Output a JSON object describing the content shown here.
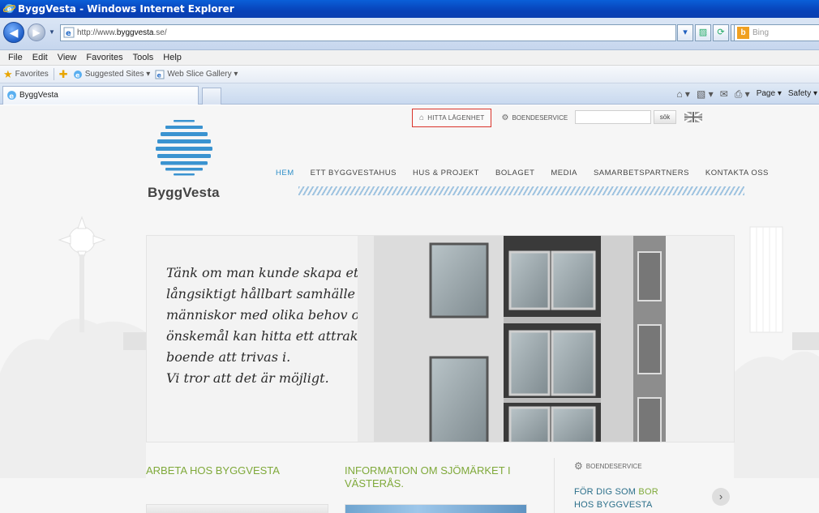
{
  "window": {
    "title": "ByggVesta - Windows Internet Explorer"
  },
  "address": {
    "url_prefix": "http://www.",
    "url_domain": "byggvesta",
    "url_suffix": ".se/",
    "search_placeholder": "Bing"
  },
  "menu": {
    "items": [
      "File",
      "Edit",
      "View",
      "Favorites",
      "Tools",
      "Help"
    ]
  },
  "favorites": {
    "label": "Favorites",
    "suggested": "Suggested Sites ▾",
    "gallery": "Web Slice Gallery ▾"
  },
  "tabs": {
    "active_label": "ByggVesta"
  },
  "commandbar": {
    "page": "Page ▾",
    "safety": "Safety ▾"
  },
  "site": {
    "logo_text": "ByggVesta",
    "top_links": {
      "hitta": "HITTA LÄGENHET",
      "boende": "BOENDESERVICE",
      "search_button": "sök"
    },
    "nav": [
      "HEM",
      "ETT BYGGVESTAHUS",
      "HUS & PROJEKT",
      "BOLAGET",
      "MEDIA",
      "SAMARBETSPARTNERS",
      "KONTAKTA OSS"
    ],
    "hero_lines": [
      "Tänk om man kunde skapa ett",
      "långsiktigt hållbart samhälle där",
      "människor med olika behov och",
      "önskemål kan hitta ett attraktivt",
      "boende att trivas i.",
      "Vi tror att det är möjligt."
    ],
    "col1_title": "ARBETA HOS BYGGVESTA",
    "col2_title_1": "INFORMATION OM SJÖMÄRKET I",
    "col2_title_2": "VÄSTERÅS.",
    "col3_label": "BOENDESERVICE",
    "col3_line1_a": "FÖR DIG SOM ",
    "col3_line1_b": "BOR",
    "col3_line2": "HOS BYGGVESTA",
    "col3_arrow": "›"
  }
}
